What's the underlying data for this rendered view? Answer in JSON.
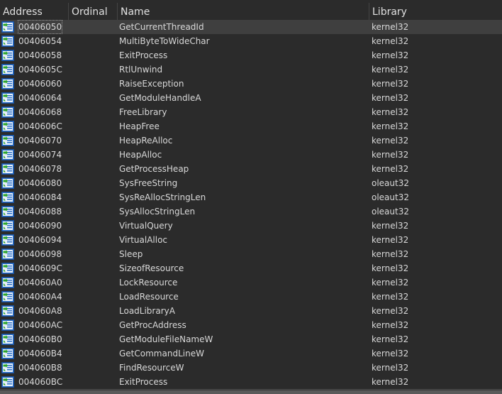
{
  "columns": {
    "address": "Address",
    "ordinal": "Ordinal",
    "name": "Name",
    "library": "Library"
  },
  "icon": "import-function-icon",
  "colors": {
    "background": "#2b2b2b",
    "selected_row": "#3f3f3f",
    "icon_blue": "#2a6fc9",
    "icon_green": "#2aa52a"
  },
  "rows": [
    {
      "address": "00406050",
      "ordinal": "",
      "name": "GetCurrentThreadId",
      "library": "kernel32",
      "selected": true
    },
    {
      "address": "00406054",
      "ordinal": "",
      "name": "MultiByteToWideChar",
      "library": "kernel32"
    },
    {
      "address": "00406058",
      "ordinal": "",
      "name": "ExitProcess",
      "library": "kernel32"
    },
    {
      "address": "0040605C",
      "ordinal": "",
      "name": "RtlUnwind",
      "library": "kernel32"
    },
    {
      "address": "00406060",
      "ordinal": "",
      "name": "RaiseException",
      "library": "kernel32"
    },
    {
      "address": "00406064",
      "ordinal": "",
      "name": "GetModuleHandleA",
      "library": "kernel32"
    },
    {
      "address": "00406068",
      "ordinal": "",
      "name": "FreeLibrary",
      "library": "kernel32"
    },
    {
      "address": "0040606C",
      "ordinal": "",
      "name": "HeapFree",
      "library": "kernel32"
    },
    {
      "address": "00406070",
      "ordinal": "",
      "name": "HeapReAlloc",
      "library": "kernel32"
    },
    {
      "address": "00406074",
      "ordinal": "",
      "name": "HeapAlloc",
      "library": "kernel32"
    },
    {
      "address": "00406078",
      "ordinal": "",
      "name": "GetProcessHeap",
      "library": "kernel32"
    },
    {
      "address": "00406080",
      "ordinal": "",
      "name": "SysFreeString",
      "library": "oleaut32"
    },
    {
      "address": "00406084",
      "ordinal": "",
      "name": "SysReAllocStringLen",
      "library": "oleaut32"
    },
    {
      "address": "00406088",
      "ordinal": "",
      "name": "SysAllocStringLen",
      "library": "oleaut32"
    },
    {
      "address": "00406090",
      "ordinal": "",
      "name": "VirtualQuery",
      "library": "kernel32"
    },
    {
      "address": "00406094",
      "ordinal": "",
      "name": "VirtualAlloc",
      "library": "kernel32"
    },
    {
      "address": "00406098",
      "ordinal": "",
      "name": "Sleep",
      "library": "kernel32"
    },
    {
      "address": "0040609C",
      "ordinal": "",
      "name": "SizeofResource",
      "library": "kernel32"
    },
    {
      "address": "004060A0",
      "ordinal": "",
      "name": "LockResource",
      "library": "kernel32"
    },
    {
      "address": "004060A4",
      "ordinal": "",
      "name": "LoadResource",
      "library": "kernel32"
    },
    {
      "address": "004060A8",
      "ordinal": "",
      "name": "LoadLibraryA",
      "library": "kernel32"
    },
    {
      "address": "004060AC",
      "ordinal": "",
      "name": "GetProcAddress",
      "library": "kernel32"
    },
    {
      "address": "004060B0",
      "ordinal": "",
      "name": "GetModuleFileNameW",
      "library": "kernel32"
    },
    {
      "address": "004060B4",
      "ordinal": "",
      "name": "GetCommandLineW",
      "library": "kernel32"
    },
    {
      "address": "004060B8",
      "ordinal": "",
      "name": "FindResourceW",
      "library": "kernel32"
    },
    {
      "address": "004060BC",
      "ordinal": "",
      "name": "ExitProcess",
      "library": "kernel32"
    }
  ]
}
